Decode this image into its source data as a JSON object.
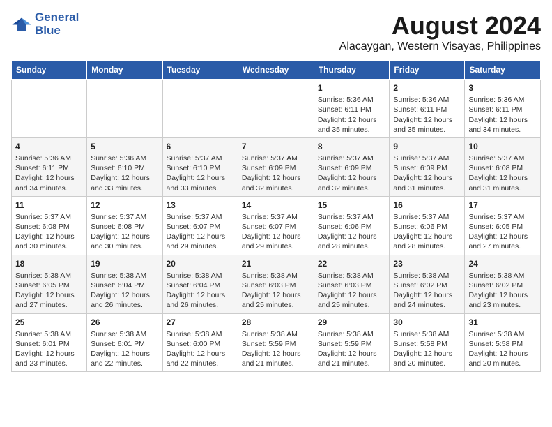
{
  "logo": {
    "line1": "General",
    "line2": "Blue"
  },
  "title": "August 2024",
  "subtitle": "Alacaygan, Western Visayas, Philippines",
  "days_of_week": [
    "Sunday",
    "Monday",
    "Tuesday",
    "Wednesday",
    "Thursday",
    "Friday",
    "Saturday"
  ],
  "weeks": [
    [
      {
        "day": "",
        "info": ""
      },
      {
        "day": "",
        "info": ""
      },
      {
        "day": "",
        "info": ""
      },
      {
        "day": "",
        "info": ""
      },
      {
        "day": "1",
        "info": "Sunrise: 5:36 AM\nSunset: 6:11 PM\nDaylight: 12 hours\nand 35 minutes."
      },
      {
        "day": "2",
        "info": "Sunrise: 5:36 AM\nSunset: 6:11 PM\nDaylight: 12 hours\nand 35 minutes."
      },
      {
        "day": "3",
        "info": "Sunrise: 5:36 AM\nSunset: 6:11 PM\nDaylight: 12 hours\nand 34 minutes."
      }
    ],
    [
      {
        "day": "4",
        "info": "Sunrise: 5:36 AM\nSunset: 6:11 PM\nDaylight: 12 hours\nand 34 minutes."
      },
      {
        "day": "5",
        "info": "Sunrise: 5:36 AM\nSunset: 6:10 PM\nDaylight: 12 hours\nand 33 minutes."
      },
      {
        "day": "6",
        "info": "Sunrise: 5:37 AM\nSunset: 6:10 PM\nDaylight: 12 hours\nand 33 minutes."
      },
      {
        "day": "7",
        "info": "Sunrise: 5:37 AM\nSunset: 6:09 PM\nDaylight: 12 hours\nand 32 minutes."
      },
      {
        "day": "8",
        "info": "Sunrise: 5:37 AM\nSunset: 6:09 PM\nDaylight: 12 hours\nand 32 minutes."
      },
      {
        "day": "9",
        "info": "Sunrise: 5:37 AM\nSunset: 6:09 PM\nDaylight: 12 hours\nand 31 minutes."
      },
      {
        "day": "10",
        "info": "Sunrise: 5:37 AM\nSunset: 6:08 PM\nDaylight: 12 hours\nand 31 minutes."
      }
    ],
    [
      {
        "day": "11",
        "info": "Sunrise: 5:37 AM\nSunset: 6:08 PM\nDaylight: 12 hours\nand 30 minutes."
      },
      {
        "day": "12",
        "info": "Sunrise: 5:37 AM\nSunset: 6:08 PM\nDaylight: 12 hours\nand 30 minutes."
      },
      {
        "day": "13",
        "info": "Sunrise: 5:37 AM\nSunset: 6:07 PM\nDaylight: 12 hours\nand 29 minutes."
      },
      {
        "day": "14",
        "info": "Sunrise: 5:37 AM\nSunset: 6:07 PM\nDaylight: 12 hours\nand 29 minutes."
      },
      {
        "day": "15",
        "info": "Sunrise: 5:37 AM\nSunset: 6:06 PM\nDaylight: 12 hours\nand 28 minutes."
      },
      {
        "day": "16",
        "info": "Sunrise: 5:37 AM\nSunset: 6:06 PM\nDaylight: 12 hours\nand 28 minutes."
      },
      {
        "day": "17",
        "info": "Sunrise: 5:37 AM\nSunset: 6:05 PM\nDaylight: 12 hours\nand 27 minutes."
      }
    ],
    [
      {
        "day": "18",
        "info": "Sunrise: 5:38 AM\nSunset: 6:05 PM\nDaylight: 12 hours\nand 27 minutes."
      },
      {
        "day": "19",
        "info": "Sunrise: 5:38 AM\nSunset: 6:04 PM\nDaylight: 12 hours\nand 26 minutes."
      },
      {
        "day": "20",
        "info": "Sunrise: 5:38 AM\nSunset: 6:04 PM\nDaylight: 12 hours\nand 26 minutes."
      },
      {
        "day": "21",
        "info": "Sunrise: 5:38 AM\nSunset: 6:03 PM\nDaylight: 12 hours\nand 25 minutes."
      },
      {
        "day": "22",
        "info": "Sunrise: 5:38 AM\nSunset: 6:03 PM\nDaylight: 12 hours\nand 25 minutes."
      },
      {
        "day": "23",
        "info": "Sunrise: 5:38 AM\nSunset: 6:02 PM\nDaylight: 12 hours\nand 24 minutes."
      },
      {
        "day": "24",
        "info": "Sunrise: 5:38 AM\nSunset: 6:02 PM\nDaylight: 12 hours\nand 23 minutes."
      }
    ],
    [
      {
        "day": "25",
        "info": "Sunrise: 5:38 AM\nSunset: 6:01 PM\nDaylight: 12 hours\nand 23 minutes."
      },
      {
        "day": "26",
        "info": "Sunrise: 5:38 AM\nSunset: 6:01 PM\nDaylight: 12 hours\nand 22 minutes."
      },
      {
        "day": "27",
        "info": "Sunrise: 5:38 AM\nSunset: 6:00 PM\nDaylight: 12 hours\nand 22 minutes."
      },
      {
        "day": "28",
        "info": "Sunrise: 5:38 AM\nSunset: 5:59 PM\nDaylight: 12 hours\nand 21 minutes."
      },
      {
        "day": "29",
        "info": "Sunrise: 5:38 AM\nSunset: 5:59 PM\nDaylight: 12 hours\nand 21 minutes."
      },
      {
        "day": "30",
        "info": "Sunrise: 5:38 AM\nSunset: 5:58 PM\nDaylight: 12 hours\nand 20 minutes."
      },
      {
        "day": "31",
        "info": "Sunrise: 5:38 AM\nSunset: 5:58 PM\nDaylight: 12 hours\nand 20 minutes."
      }
    ]
  ]
}
